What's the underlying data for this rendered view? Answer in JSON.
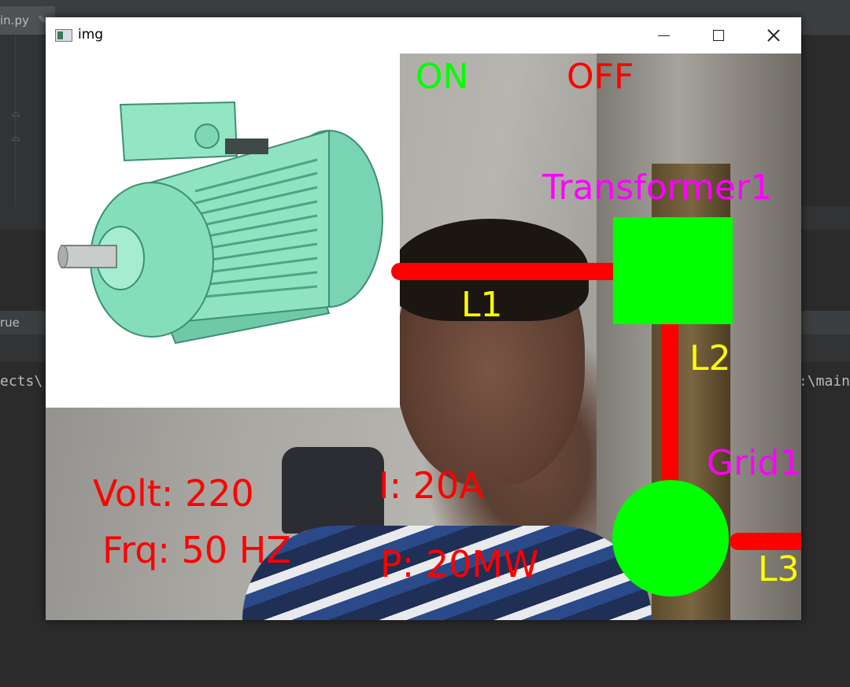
{
  "ide": {
    "tab_label": "in.py",
    "run_bar_label": "rue",
    "console_left_text": "ects\\",
    "console_right_text": ":\\main"
  },
  "window": {
    "title": "img",
    "controls": [
      "minimize-icon",
      "maximize-icon",
      "close-icon"
    ]
  },
  "overlay": {
    "status_on": "ON",
    "status_off": "OFF",
    "transformer_label": "Transformer1",
    "grid_label": "Grid1",
    "line_labels": [
      "L1",
      "L2",
      "L3"
    ],
    "readings": {
      "volt": "Volt: 220",
      "freq": "Frq: 50 HZ",
      "current": "I: 20A",
      "power": "P: 20MW"
    },
    "colors": {
      "on": "#00ff00",
      "off": "#ff0000",
      "label_magenta": "#ff00ff",
      "line_label_yellow": "#ffff00",
      "reading_red": "#ff0000",
      "node_green": "#00ff00",
      "line_red": "#ff0000",
      "motor_body": "#8fe3c0"
    }
  }
}
